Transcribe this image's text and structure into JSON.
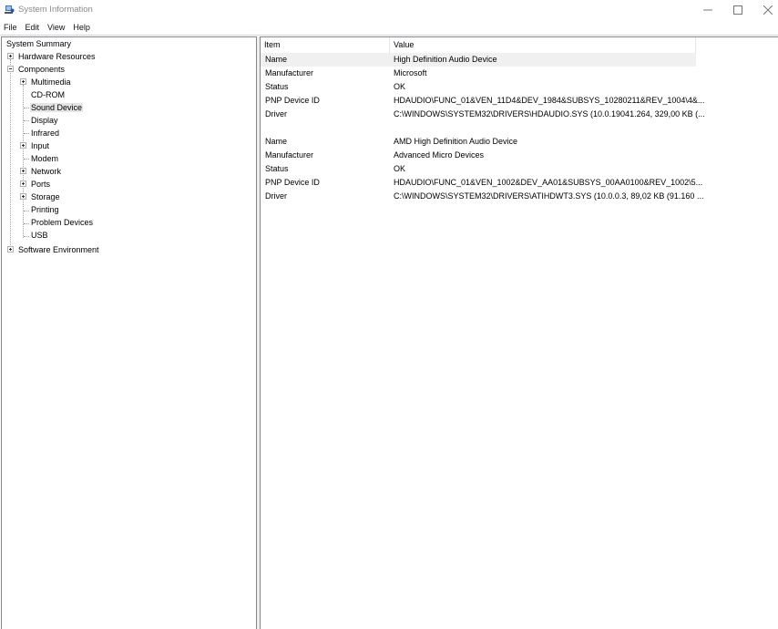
{
  "window": {
    "title": "System Information"
  },
  "menu": [
    "File",
    "Edit",
    "View",
    "Help"
  ],
  "tree": {
    "root": "System Summary",
    "hardware": "Hardware Resources",
    "components": "Components",
    "children": [
      "Multimedia",
      "CD-ROM",
      "Sound Device",
      "Display",
      "Infrared",
      "Input",
      "Modem",
      "Network",
      "Ports",
      "Storage",
      "Printing",
      "Problem Devices",
      "USB"
    ],
    "software": "Software Environment"
  },
  "table": {
    "headers": [
      "Item",
      "Value"
    ],
    "rows": [
      {
        "item": "Name",
        "value": "High Definition Audio Device"
      },
      {
        "item": "Manufacturer",
        "value": "Microsoft"
      },
      {
        "item": "Status",
        "value": "OK"
      },
      {
        "item": "PNP Device ID",
        "value": "HDAUDIO\\FUNC_01&VEN_11D4&DEV_1984&SUBSYS_10280211&REV_1004\\4&..."
      },
      {
        "item": "Driver",
        "value": "C:\\WINDOWS\\SYSTEM32\\DRIVERS\\HDAUDIO.SYS (10.0.19041.264, 329,00 KB (..."
      },
      {
        "item": "",
        "value": ""
      },
      {
        "item": "Name",
        "value": "AMD High Definition Audio Device"
      },
      {
        "item": "Manufacturer",
        "value": "Advanced Micro Devices"
      },
      {
        "item": "Status",
        "value": "OK"
      },
      {
        "item": "PNP Device ID",
        "value": "HDAUDIO\\FUNC_01&VEN_1002&DEV_AA01&SUBSYS_00AA0100&REV_1002\\5..."
      },
      {
        "item": "Driver",
        "value": "C:\\WINDOWS\\SYSTEM32\\DRIVERS\\ATIHDWT3.SYS (10.0.0.3, 89,02 KB (91.160 ..."
      }
    ]
  }
}
